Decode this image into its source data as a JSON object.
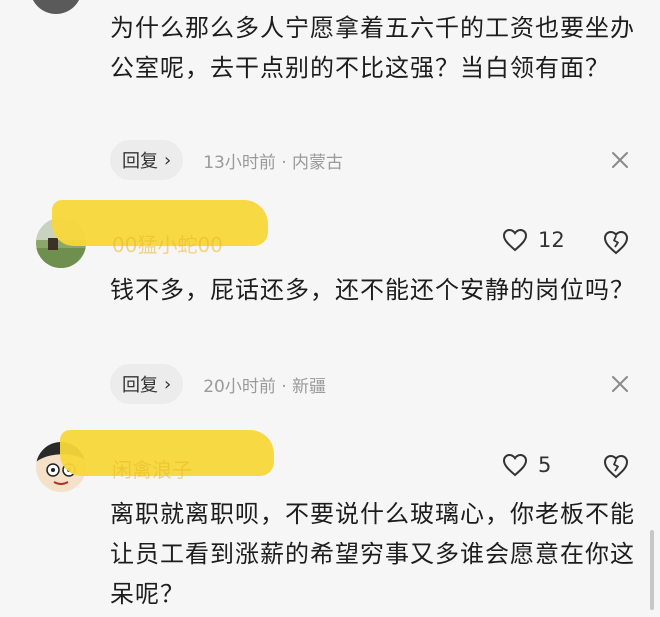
{
  "comments": [
    {
      "text": "为什么那么多人宁愿拿着五六千的工资也要坐办公室呢，去干点别的不比这强？当白领有面？",
      "reply_label": "回复",
      "meta": "13小时前 · 内蒙古"
    },
    {
      "username": "00猛小蛇00",
      "likes": "12",
      "text": "钱不多，屁话还多，还不能还个安静的岗位吗？",
      "reply_label": "回复",
      "meta": "20小时前 · 新疆"
    },
    {
      "username": "闲禽浪子",
      "likes": "5",
      "text": "离职就离职呗，不要说什么玻璃心，你老板不能让员工看到涨薪的希望穷事又多谁会愿意在你这呆呢？"
    }
  ],
  "icons": {
    "reply_chevron": "chevron-right-icon",
    "close": "close-icon",
    "like": "heart-icon",
    "dislike": "heart-broken-icon"
  },
  "colors": {
    "background": "#f6f6f6",
    "redaction": "#f7d73a",
    "meta": "#9a9a9a"
  }
}
